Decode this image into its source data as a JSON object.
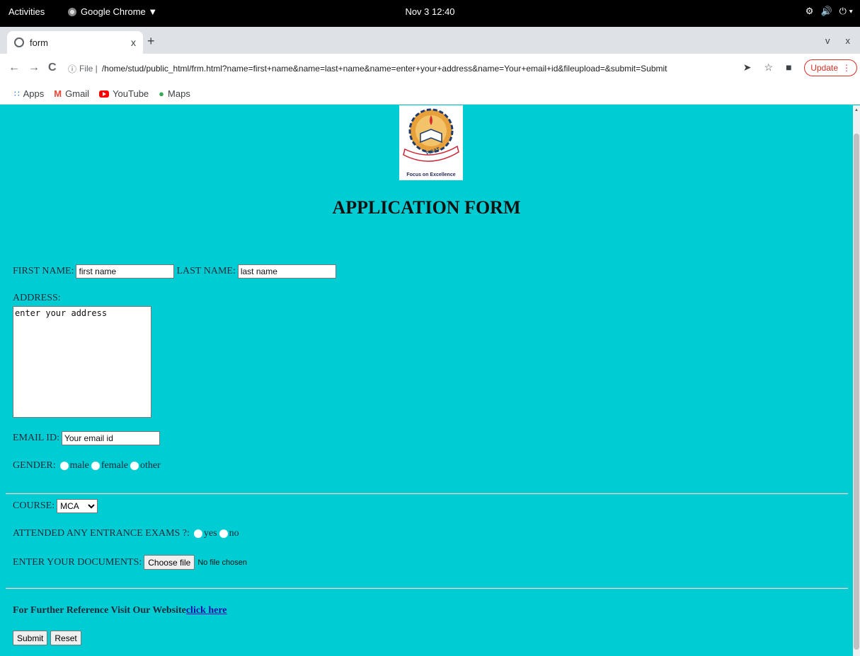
{
  "topbar": {
    "activities": "Activities",
    "app": "Google Chrome ▼",
    "clock": "Nov 3  12:40",
    "sys_icons": [
      "network-icon",
      "volume-icon",
      "power-icon"
    ]
  },
  "tab": {
    "title": "form",
    "close": "x",
    "new": "+"
  },
  "tabstrip": {
    "down": "v",
    "close": "x"
  },
  "nav": {
    "back": "←",
    "forward": "→",
    "reload": "C",
    "info": "ⓘ",
    "scheme": "File |",
    "url": "/home/stud/public_html/frm.html?name=first+name&name=last+name&name=enter+your+address&name=Your+email+id&fileupload=&submit=Submit",
    "update": "Update"
  },
  "bookmarks": [
    {
      "label": "Apps"
    },
    {
      "label": "Gmail"
    },
    {
      "label": "YouTube"
    },
    {
      "label": "Maps"
    }
  ],
  "logo": {
    "caption": "Focus on Excellence",
    "badge": "FISAT"
  },
  "form": {
    "heading": "APPLICATION FORM",
    "first_name_label": "FIRST NAME:",
    "first_name_value": "first name",
    "last_name_label": "LAST NAME:",
    "last_name_value": "last name",
    "address_label": "ADDRESS:",
    "address_value": "enter your address",
    "email_label": "EMAIL ID:",
    "email_value": "Your email id",
    "gender_label": "GENDER:",
    "gender_options": [
      "male",
      "female",
      "other"
    ],
    "course_label": "COURSE:",
    "course_value": "MCA",
    "exam_label": "ATTENDED ANY ENTRANCE EXAMS ?:",
    "exam_options": [
      "yes",
      "no"
    ],
    "docs_label": "ENTER YOUR DOCUMENTS:",
    "choose_file": "Choose file",
    "no_file": "No file chosen",
    "reference_text": "For Further Reference Visit Our Website",
    "reference_link": "click here",
    "submit": "Submit",
    "reset": "Reset"
  },
  "colors": {
    "page_bg": "#00cdd3",
    "update_red": "#d93025"
  }
}
